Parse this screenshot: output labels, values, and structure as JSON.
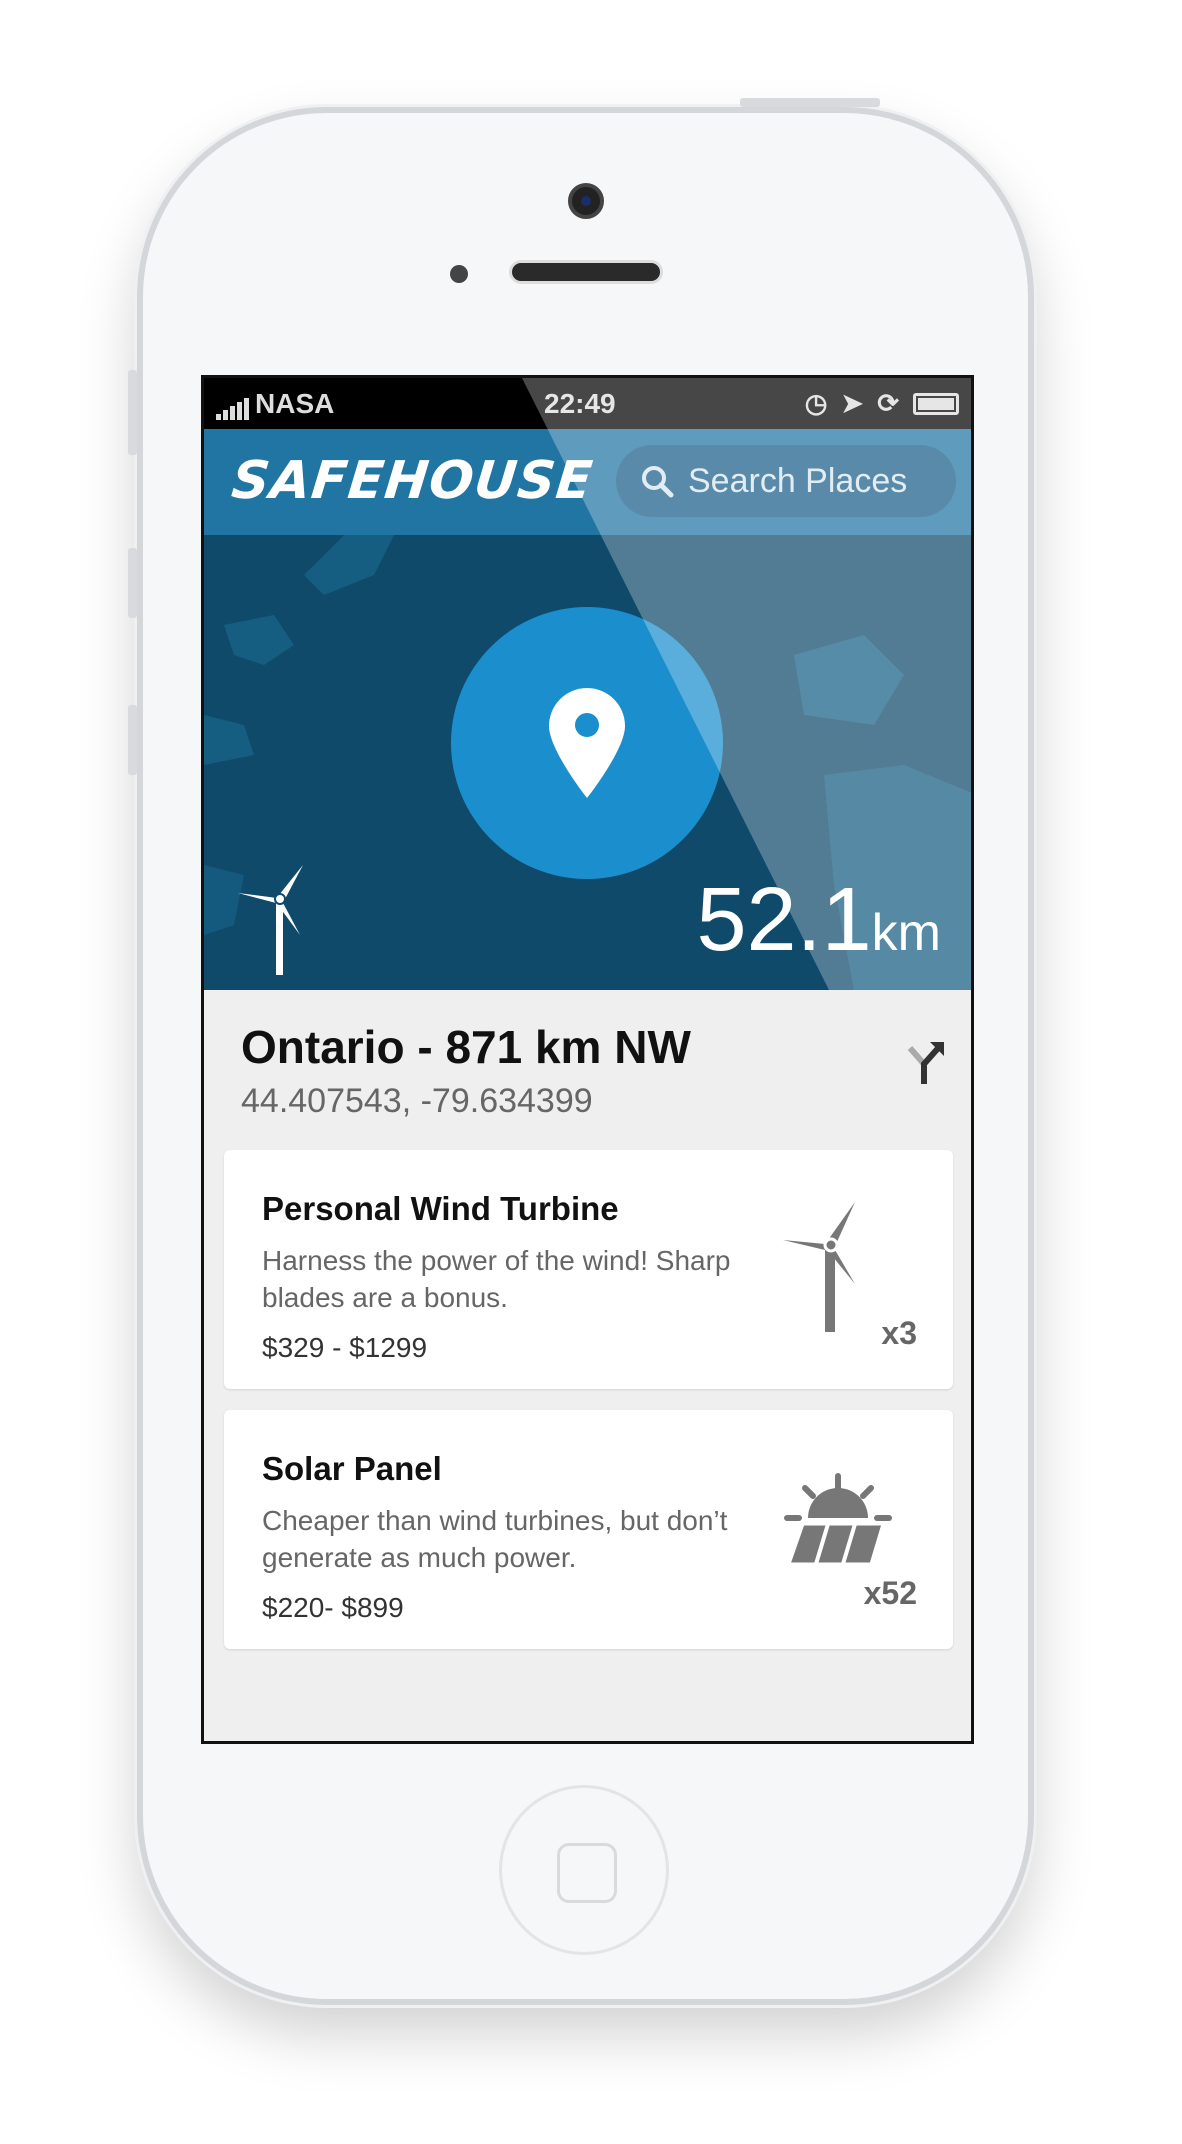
{
  "status_bar": {
    "carrier": "NASA",
    "time": "22:49"
  },
  "header": {
    "logo": "SAFEHOUSE",
    "search_placeholder": "Search Places"
  },
  "map": {
    "distance_value": "52.1",
    "distance_unit": "km"
  },
  "location": {
    "title": "Ontario - 871 km NW",
    "coordinates": "44.407543, -79.634399"
  },
  "items": [
    {
      "title": "Personal Wind Turbine",
      "description": "Harness the power of the wind! Sharp blades are a bonus.",
      "price": "$329 - $1299",
      "quantity": "x3",
      "icon": "wind-turbine-icon"
    },
    {
      "title": "Solar Panel",
      "description": "Cheaper than wind turbines, but don’t generate as much power.",
      "price": "$220- $899",
      "quantity": "x52",
      "icon": "solar-panel-icon"
    }
  ],
  "colors": {
    "header": "#2175a3",
    "map": "#0f4a6a",
    "pin_circle": "#1b8fcd"
  }
}
